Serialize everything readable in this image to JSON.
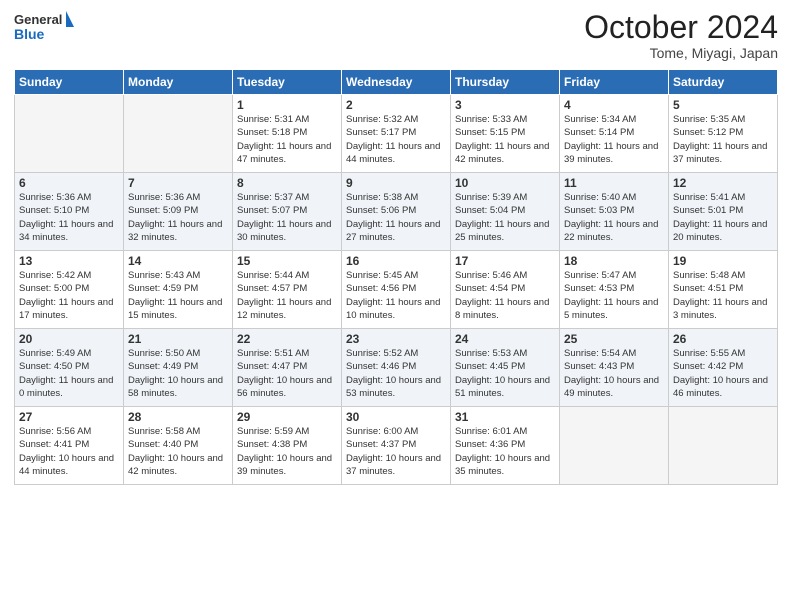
{
  "header": {
    "logo_general": "General",
    "logo_blue": "Blue",
    "month_title": "October 2024",
    "location": "Tome, Miyagi, Japan"
  },
  "days_of_week": [
    "Sunday",
    "Monday",
    "Tuesday",
    "Wednesday",
    "Thursday",
    "Friday",
    "Saturday"
  ],
  "weeks": [
    [
      {
        "day": "",
        "info": ""
      },
      {
        "day": "",
        "info": ""
      },
      {
        "day": "1",
        "info": "Sunrise: 5:31 AM\nSunset: 5:18 PM\nDaylight: 11 hours and 47 minutes."
      },
      {
        "day": "2",
        "info": "Sunrise: 5:32 AM\nSunset: 5:17 PM\nDaylight: 11 hours and 44 minutes."
      },
      {
        "day": "3",
        "info": "Sunrise: 5:33 AM\nSunset: 5:15 PM\nDaylight: 11 hours and 42 minutes."
      },
      {
        "day": "4",
        "info": "Sunrise: 5:34 AM\nSunset: 5:14 PM\nDaylight: 11 hours and 39 minutes."
      },
      {
        "day": "5",
        "info": "Sunrise: 5:35 AM\nSunset: 5:12 PM\nDaylight: 11 hours and 37 minutes."
      }
    ],
    [
      {
        "day": "6",
        "info": "Sunrise: 5:36 AM\nSunset: 5:10 PM\nDaylight: 11 hours and 34 minutes."
      },
      {
        "day": "7",
        "info": "Sunrise: 5:36 AM\nSunset: 5:09 PM\nDaylight: 11 hours and 32 minutes."
      },
      {
        "day": "8",
        "info": "Sunrise: 5:37 AM\nSunset: 5:07 PM\nDaylight: 11 hours and 30 minutes."
      },
      {
        "day": "9",
        "info": "Sunrise: 5:38 AM\nSunset: 5:06 PM\nDaylight: 11 hours and 27 minutes."
      },
      {
        "day": "10",
        "info": "Sunrise: 5:39 AM\nSunset: 5:04 PM\nDaylight: 11 hours and 25 minutes."
      },
      {
        "day": "11",
        "info": "Sunrise: 5:40 AM\nSunset: 5:03 PM\nDaylight: 11 hours and 22 minutes."
      },
      {
        "day": "12",
        "info": "Sunrise: 5:41 AM\nSunset: 5:01 PM\nDaylight: 11 hours and 20 minutes."
      }
    ],
    [
      {
        "day": "13",
        "info": "Sunrise: 5:42 AM\nSunset: 5:00 PM\nDaylight: 11 hours and 17 minutes."
      },
      {
        "day": "14",
        "info": "Sunrise: 5:43 AM\nSunset: 4:59 PM\nDaylight: 11 hours and 15 minutes."
      },
      {
        "day": "15",
        "info": "Sunrise: 5:44 AM\nSunset: 4:57 PM\nDaylight: 11 hours and 12 minutes."
      },
      {
        "day": "16",
        "info": "Sunrise: 5:45 AM\nSunset: 4:56 PM\nDaylight: 11 hours and 10 minutes."
      },
      {
        "day": "17",
        "info": "Sunrise: 5:46 AM\nSunset: 4:54 PM\nDaylight: 11 hours and 8 minutes."
      },
      {
        "day": "18",
        "info": "Sunrise: 5:47 AM\nSunset: 4:53 PM\nDaylight: 11 hours and 5 minutes."
      },
      {
        "day": "19",
        "info": "Sunrise: 5:48 AM\nSunset: 4:51 PM\nDaylight: 11 hours and 3 minutes."
      }
    ],
    [
      {
        "day": "20",
        "info": "Sunrise: 5:49 AM\nSunset: 4:50 PM\nDaylight: 11 hours and 0 minutes."
      },
      {
        "day": "21",
        "info": "Sunrise: 5:50 AM\nSunset: 4:49 PM\nDaylight: 10 hours and 58 minutes."
      },
      {
        "day": "22",
        "info": "Sunrise: 5:51 AM\nSunset: 4:47 PM\nDaylight: 10 hours and 56 minutes."
      },
      {
        "day": "23",
        "info": "Sunrise: 5:52 AM\nSunset: 4:46 PM\nDaylight: 10 hours and 53 minutes."
      },
      {
        "day": "24",
        "info": "Sunrise: 5:53 AM\nSunset: 4:45 PM\nDaylight: 10 hours and 51 minutes."
      },
      {
        "day": "25",
        "info": "Sunrise: 5:54 AM\nSunset: 4:43 PM\nDaylight: 10 hours and 49 minutes."
      },
      {
        "day": "26",
        "info": "Sunrise: 5:55 AM\nSunset: 4:42 PM\nDaylight: 10 hours and 46 minutes."
      }
    ],
    [
      {
        "day": "27",
        "info": "Sunrise: 5:56 AM\nSunset: 4:41 PM\nDaylight: 10 hours and 44 minutes."
      },
      {
        "day": "28",
        "info": "Sunrise: 5:58 AM\nSunset: 4:40 PM\nDaylight: 10 hours and 42 minutes."
      },
      {
        "day": "29",
        "info": "Sunrise: 5:59 AM\nSunset: 4:38 PM\nDaylight: 10 hours and 39 minutes."
      },
      {
        "day": "30",
        "info": "Sunrise: 6:00 AM\nSunset: 4:37 PM\nDaylight: 10 hours and 37 minutes."
      },
      {
        "day": "31",
        "info": "Sunrise: 6:01 AM\nSunset: 4:36 PM\nDaylight: 10 hours and 35 minutes."
      },
      {
        "day": "",
        "info": ""
      },
      {
        "day": "",
        "info": ""
      }
    ]
  ]
}
